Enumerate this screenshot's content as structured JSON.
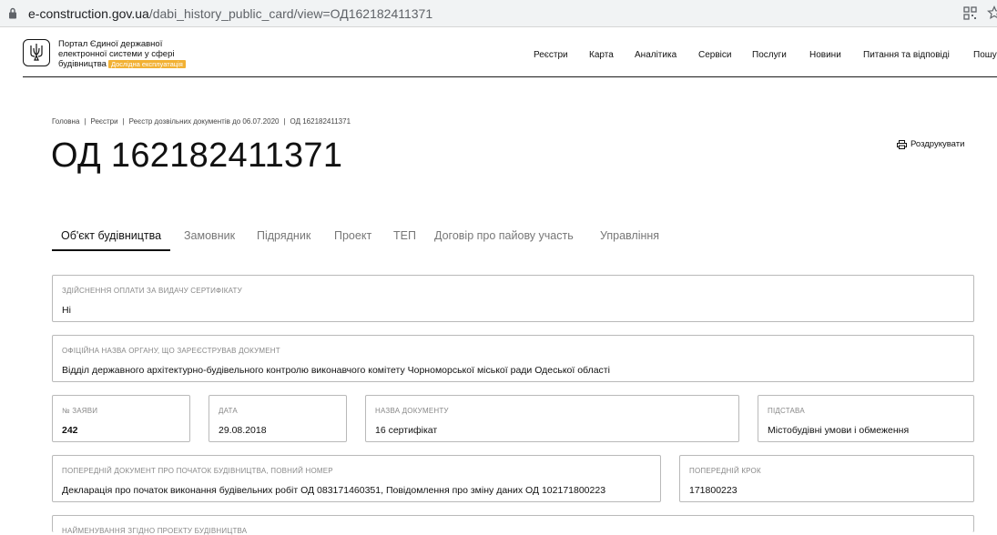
{
  "browser": {
    "url_domain": "e-construction.gov.ua",
    "url_path": "/dabi_history_public_card/view=ОД162182411371"
  },
  "header": {
    "portal_name_line1": "Портал Єдиної державної",
    "portal_name_line2": "електронної системи у сфері",
    "portal_name_line3": "будівництва",
    "badge": "Дослідна експлуатація",
    "nav": [
      "Реєстри",
      "Карта",
      "Аналітика",
      "Сервіси",
      "Послуги",
      "Новини",
      "Питання та відповіді",
      "Пошу"
    ]
  },
  "breadcrumb": [
    "Головна",
    "Реєстри",
    "Реєстр дозвільних документів до 06.07.2020",
    "ОД 162182411371"
  ],
  "page": {
    "title": "ОД 162182411371",
    "print_label": "Роздрукувати"
  },
  "tabs": [
    "Об'єкт будівництва",
    "Замовник",
    "Підрядник",
    "Проект",
    "ТЕП",
    "Договір про пайову участь",
    "Управління"
  ],
  "fields": {
    "payment": {
      "label": "Здійснення оплати за видачу сертифікату",
      "value": "Ні"
    },
    "authority": {
      "label": "Офіційна назва органу, що зареєстрував документ",
      "value": "Відділ державного архітектурно-будівельного контролю виконавчого комітету Чорноморської міської ради Одеської області"
    },
    "application_no": {
      "label": "№ заяви",
      "value": "242"
    },
    "date": {
      "label": "Дата",
      "value": "29.08.2018"
    },
    "doc_name": {
      "label": "Назва документу",
      "value": "16 сертифікат"
    },
    "basis": {
      "label": "Підстава",
      "value": "Містобудівні умови і обмеження"
    },
    "prev_doc": {
      "label": "Попередній документ про початок будівництва, повний номер",
      "value": "Декларація про початок виконання будівельних робіт ОД 083171460351, Повідомлення про зміну даних ОД 102171800223"
    },
    "prev_step": {
      "label": "Попередній крок",
      "value": "171800223"
    },
    "project_name": {
      "label": "Найменування згідно проекту будівництва"
    }
  }
}
